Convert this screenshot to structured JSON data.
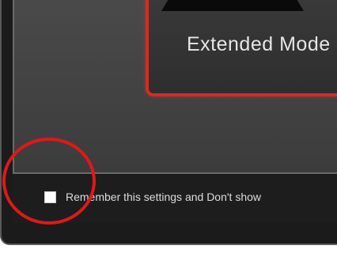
{
  "dialog": {
    "mode_label": "Extended Mode",
    "remember_label": "Remember this settings and Don't show"
  },
  "colors": {
    "accent_border": "#d52b24",
    "annotation_circle": "#e01818",
    "background": "#1b1b1b",
    "panel": "#444444"
  },
  "annotation": {
    "shape": "circle",
    "target": "remember-checkbox"
  }
}
